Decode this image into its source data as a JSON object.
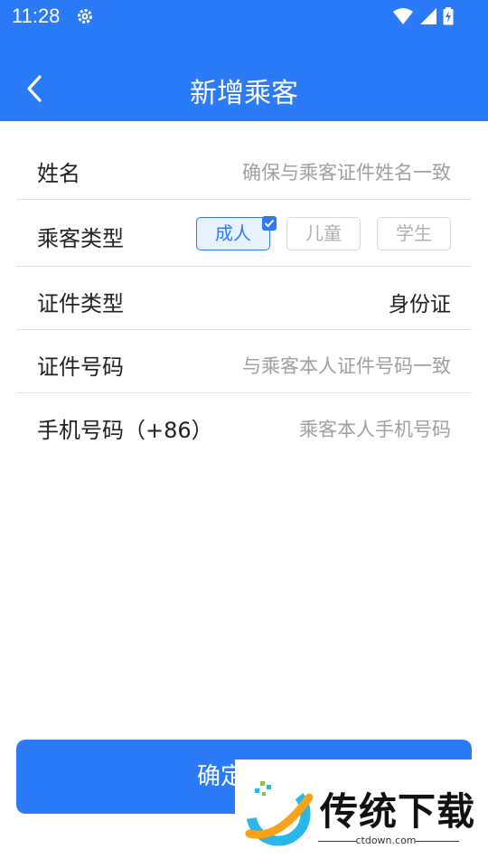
{
  "status_bar": {
    "time": "11:28"
  },
  "header": {
    "title": "新增乘客"
  },
  "form": {
    "name": {
      "label": "姓名",
      "placeholder": "确保与乘客证件姓名一致"
    },
    "passenger_type": {
      "label": "乘客类型",
      "options": [
        "成人",
        "儿童",
        "学生"
      ],
      "selected": "成人"
    },
    "id_type": {
      "label": "证件类型",
      "value": "身份证"
    },
    "id_number": {
      "label": "证件号码",
      "placeholder": "与乘客本人证件号码一致"
    },
    "phone": {
      "label": "手机号码（+86）",
      "placeholder": "乘客本人手机号码"
    }
  },
  "footer": {
    "confirm_label": "确定"
  },
  "watermark": {
    "brand": "传统下载",
    "url": "ctdown.com"
  },
  "colors": {
    "primary": "#2b7bf8",
    "placeholder": "#a0a0a0"
  }
}
